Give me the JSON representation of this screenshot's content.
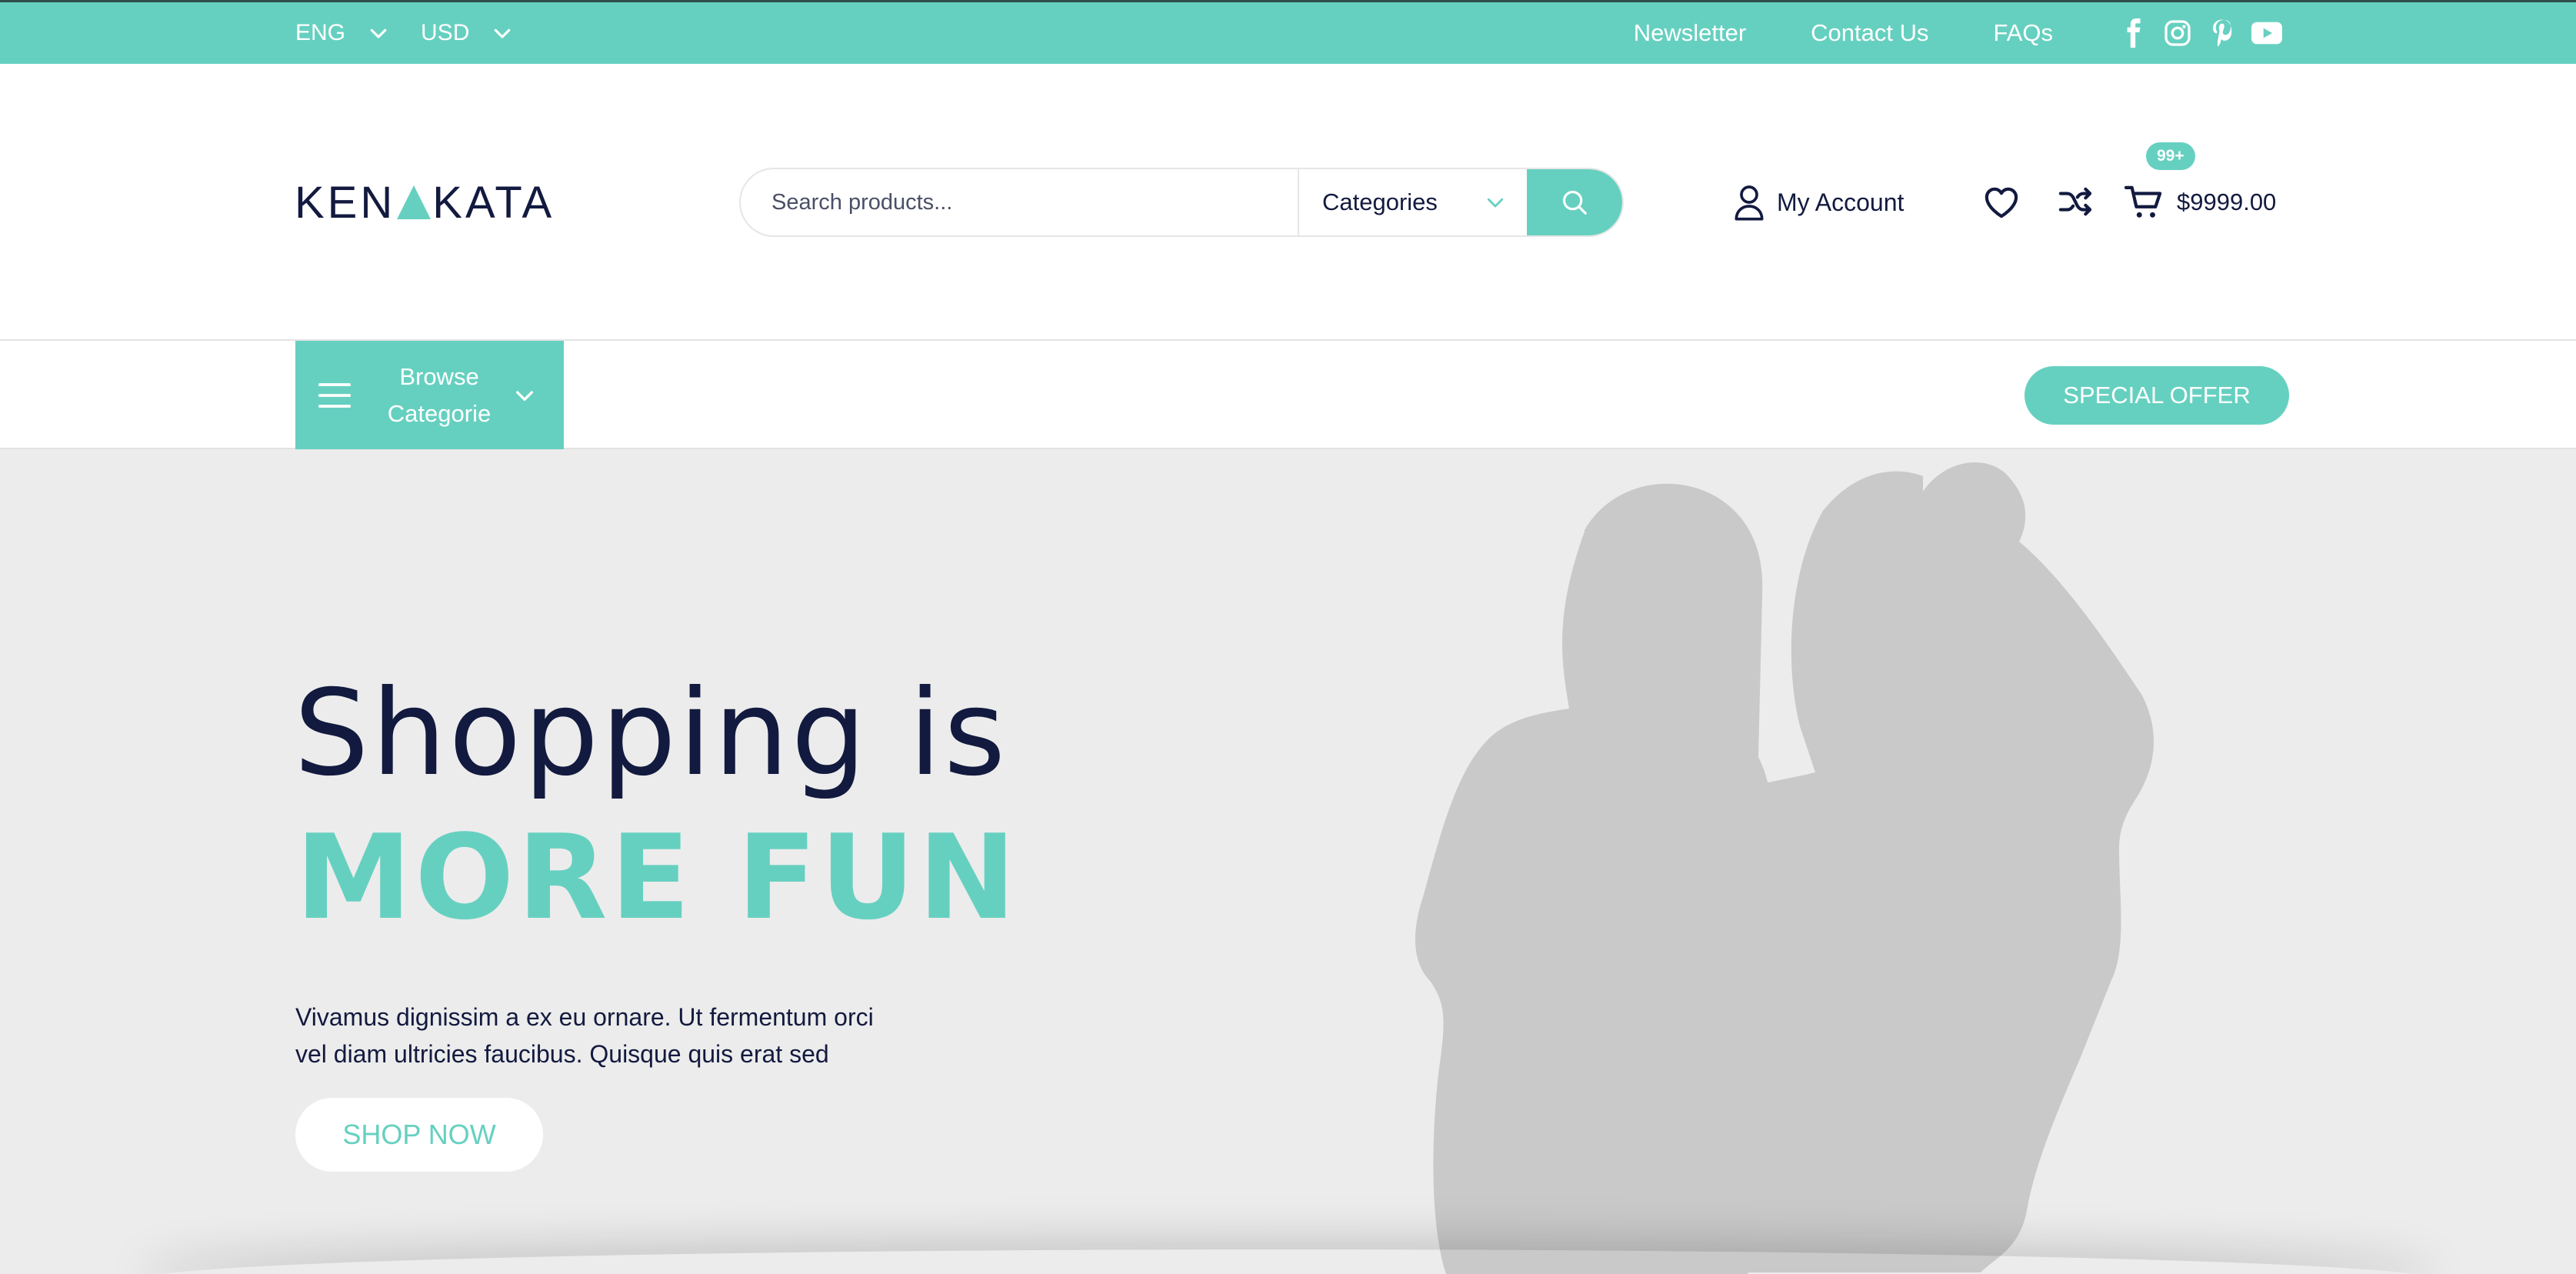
{
  "colors": {
    "accent": "#66d0c0",
    "dark": "#131a3f",
    "hero_bg": "#ececec",
    "silhouette": "#c9c9c9"
  },
  "topbar": {
    "language": "ENG",
    "currency": "USD",
    "links": [
      "Newsletter",
      "Contact Us",
      "FAQs"
    ],
    "socials": [
      "facebook-icon",
      "instagram-icon",
      "pinterest-icon",
      "youtube-icon"
    ]
  },
  "header": {
    "logo_left": "KEN",
    "logo_right": "KATA",
    "search_placeholder": "Search products...",
    "categories_label": "Categories",
    "account_label": "My Account",
    "cart_badge": "99+",
    "cart_total": "$9999.00"
  },
  "nav": {
    "browse_label": "Browse Categorie",
    "special_offer": "SPECIAL OFFER"
  },
  "hero": {
    "title_line1": "Shopping is",
    "title_line2": "MORE FUN",
    "description": "Vivamus dignissim a ex eu ornare. Ut fermentum orci vel diam ultricies faucibus. Quisque quis erat sed",
    "cta": "SHOP NOW"
  }
}
